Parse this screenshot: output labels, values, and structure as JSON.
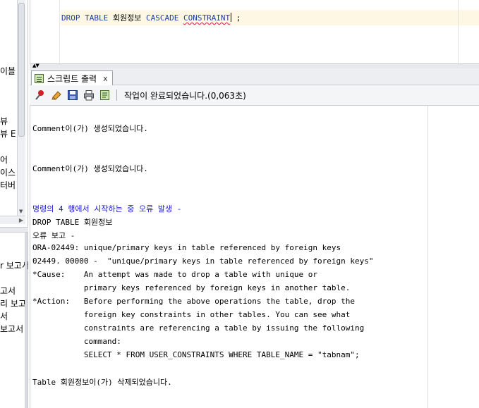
{
  "sidebar": {
    "items": [
      "이블",
      "뷰",
      "뷰 E",
      "어",
      "이스",
      "터버"
    ],
    "lower_items": [
      "r 보고서",
      "고서",
      "리 보고",
      "서",
      "보고서"
    ]
  },
  "editor": {
    "sql": {
      "kw1": "DROP TABLE ",
      "table_name": "회원정보",
      "kw2": " CASCADE ",
      "kw3": "CONSTRAINT",
      "tail": " ;"
    }
  },
  "output_panel": {
    "tab_label": "스크립트 출력",
    "tab_close": "x",
    "status": "작업이 완료되었습니다.(0,063초)",
    "toolbar": {
      "icons": [
        "pin-icon",
        "eraser-icon",
        "save-icon",
        "print-icon",
        "script-icon"
      ]
    },
    "lines": {
      "l1": "Comment이(가) 생성되었습니다.",
      "l2": "Comment이(가) 생성되었습니다.",
      "l3": "명령의 4 행에서 시작하는 중 오류 발생 -",
      "l4": "DROP TABLE 회원정보",
      "l5": "오류 보고 -",
      "l6": "ORA-02449: unique/primary keys in table referenced by foreign keys",
      "l7": "02449. 00000 -  \"unique/primary keys in table referenced by foreign keys\"",
      "l8": "*Cause:    An attempt was made to drop a table with unique or",
      "l9": "           primary keys referenced by foreign keys in another table.",
      "l10": "*Action:   Before performing the above operations the table, drop the",
      "l11": "           foreign key constraints in other tables. You can see what",
      "l12": "           constraints are referencing a table by issuing the following",
      "l13": "           command:",
      "l14": "           SELECT * FROM USER_CONSTRAINTS WHERE TABLE_NAME = \"tabnam\";",
      "l15": "Table 회원정보이(가) 삭제되었습니다."
    }
  },
  "colors": {
    "keyword": "#1f3f9e",
    "error_heading": "#1a1ad0",
    "current_line": "#fdf7e4",
    "squiggle": "#e03070"
  }
}
